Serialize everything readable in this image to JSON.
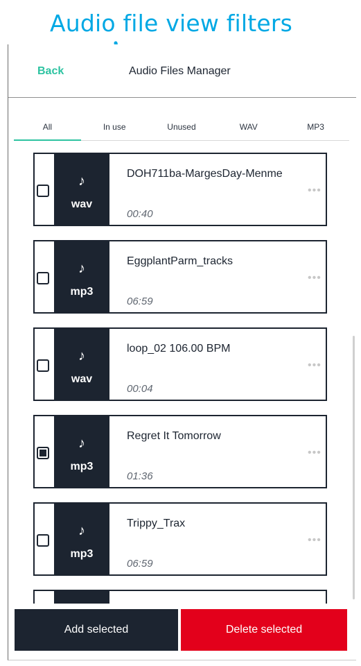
{
  "annotation": {
    "title": "Audio file view filters"
  },
  "header": {
    "back": "Back",
    "title": "Audio Files Manager"
  },
  "tabs": [
    "All",
    "In use",
    "Unused",
    "WAV",
    "MP3"
  ],
  "files": [
    {
      "name": "DOH711ba-MargesDay-Menme",
      "type": "wav",
      "duration": "00:40",
      "checked": false
    },
    {
      "name": "EggplantParm_tracks",
      "type": "mp3",
      "duration": "06:59",
      "checked": false
    },
    {
      "name": "loop_02 106.00 BPM",
      "type": "wav",
      "duration": "00:04",
      "checked": false
    },
    {
      "name": "Regret It Tomorrow",
      "type": "mp3",
      "duration": "01:36",
      "checked": true
    },
    {
      "name": "Trippy_Trax",
      "type": "mp3",
      "duration": "06:59",
      "checked": false
    }
  ],
  "icons": {
    "note": "music-note-icon",
    "more": "more-horizontal-icon"
  },
  "more_glyph": "•••",
  "note_glyph": "♪",
  "footer": {
    "add": "Add selected",
    "delete": "Delete selected"
  },
  "colors": {
    "accent": "#2dc3a1",
    "dark": "#1c2430",
    "danger": "#e3001b",
    "annotation": "#00a8e4"
  }
}
